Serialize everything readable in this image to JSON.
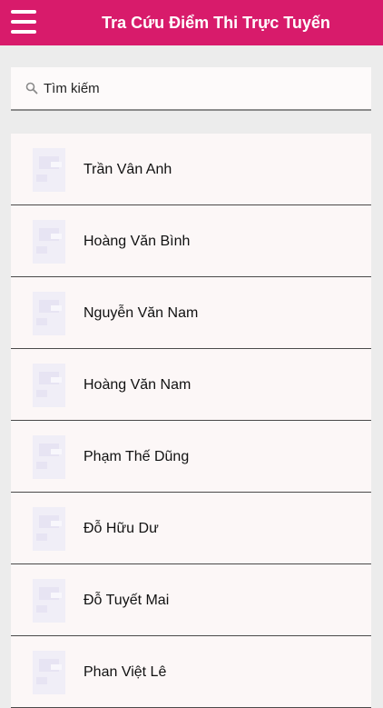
{
  "header": {
    "title": "Tra Cứu Điểm Thi Trực Tuyến"
  },
  "search": {
    "placeholder": "Tìm kiếm",
    "value": ""
  },
  "list": {
    "items": [
      {
        "name": "Trần Vân Anh"
      },
      {
        "name": "Hoàng Văn Bình"
      },
      {
        "name": "Nguyễn Văn Nam"
      },
      {
        "name": "Hoàng Văn Nam"
      },
      {
        "name": "Phạm Thế Dũng"
      },
      {
        "name": "Đỗ Hữu Dư"
      },
      {
        "name": "Đỗ Tuyết Mai"
      },
      {
        "name": "Phan Việt Lê"
      }
    ]
  },
  "colors": {
    "accent": "#d81b6b",
    "background": "#ececec",
    "card": "#fcf7f7"
  },
  "icons": {
    "menu": "hamburger-menu-icon",
    "search": "search-icon",
    "avatar": "avatar-placeholder-icon"
  }
}
